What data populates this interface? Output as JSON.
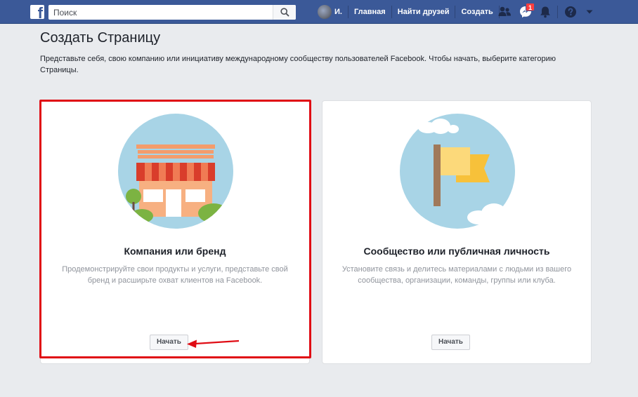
{
  "topbar": {
    "logo": "f",
    "search_placeholder": "Поиск",
    "user_name": "И.",
    "nav": [
      "Главная",
      "Найти друзей",
      "Создать"
    ],
    "messages_badge": "1",
    "icons": [
      "friends-icon",
      "messenger-icon",
      "notifications-icon",
      "help-icon",
      "chevron-down-icon"
    ]
  },
  "page": {
    "title": "Создать Страницу",
    "description": "Представьте себя, свою компанию или инициативу международному сообществу пользователей Facebook. Чтобы начать, выберите категорию Страницы."
  },
  "cards": [
    {
      "title": "Компания или бренд",
      "description": "Продемонстрируйте свои продукты и услуги, представьте свой бренд и расширьте охват клиентов на Facebook.",
      "button": "Начать",
      "illustration": "storefront-illustration"
    },
    {
      "title": "Сообщество или публичная личность",
      "description": "Установите связь и делитесь материалами с людьми из вашего сообщества, организации, команды, группы или клуба.",
      "button": "Начать",
      "illustration": "flag-illustration"
    }
  ],
  "colors": {
    "brand": "#3b5998",
    "background": "#e9ebee",
    "highlight": "#e00d15"
  }
}
